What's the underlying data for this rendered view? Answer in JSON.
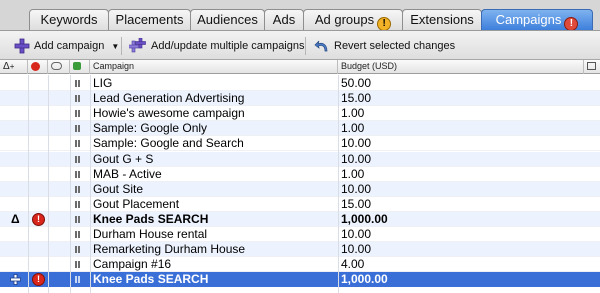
{
  "tabs": [
    {
      "label": "Keywords",
      "warn": false,
      "active": false
    },
    {
      "label": "Placements",
      "warn": false,
      "active": false
    },
    {
      "label": "Audiences",
      "warn": false,
      "active": false
    },
    {
      "label": "Ads",
      "warn": false,
      "active": false
    },
    {
      "label": "Ad groups",
      "warn": true,
      "active": false
    },
    {
      "label": "Extensions",
      "warn": false,
      "active": false
    },
    {
      "label": "Campaigns",
      "warn": true,
      "active": true
    }
  ],
  "toolbar": {
    "add_campaign": "Add campaign",
    "add_update_multiple": "Add/update multiple campaigns",
    "revert": "Revert selected changes"
  },
  "columns": {
    "campaign": "Campaign",
    "budget": "Budget (USD)"
  },
  "rows": [
    {
      "name": "LIG",
      "budget": "50.00"
    },
    {
      "name": "Lead Generation Advertising",
      "budget": "15.00"
    },
    {
      "name": "Howie's awesome campaign",
      "budget": "1.00"
    },
    {
      "name": "Sample: Google Only",
      "budget": "1.00"
    },
    {
      "name": "Sample: Google and Search",
      "budget": "10.00"
    },
    {
      "name": "Gout G + S",
      "budget": "10.00"
    },
    {
      "name": "MAB - Active",
      "budget": "1.00"
    },
    {
      "name": "Gout Site",
      "budget": "10.00"
    },
    {
      "name": "Gout Placement",
      "budget": "15.00"
    },
    {
      "name": "Knee Pads SEARCH",
      "budget": "1,000.00",
      "bold": true,
      "delta": "Δ",
      "error": true
    },
    {
      "name": "Durham House rental",
      "budget": "10.00"
    },
    {
      "name": "Remarketing Durham House",
      "budget": "10.00"
    },
    {
      "name": "Campaign #16",
      "budget": "4.00"
    },
    {
      "name": "Knee Pads SEARCH",
      "budget": "1,000.00",
      "bold": true,
      "added": true,
      "error": true,
      "selected": true
    }
  ],
  "colors": {
    "selected_row": "#3a6fd8",
    "alt_row": "#edf3fe",
    "active_tab": "#3d7fdc",
    "warning": "#f2b227",
    "error": "#d9261c"
  }
}
